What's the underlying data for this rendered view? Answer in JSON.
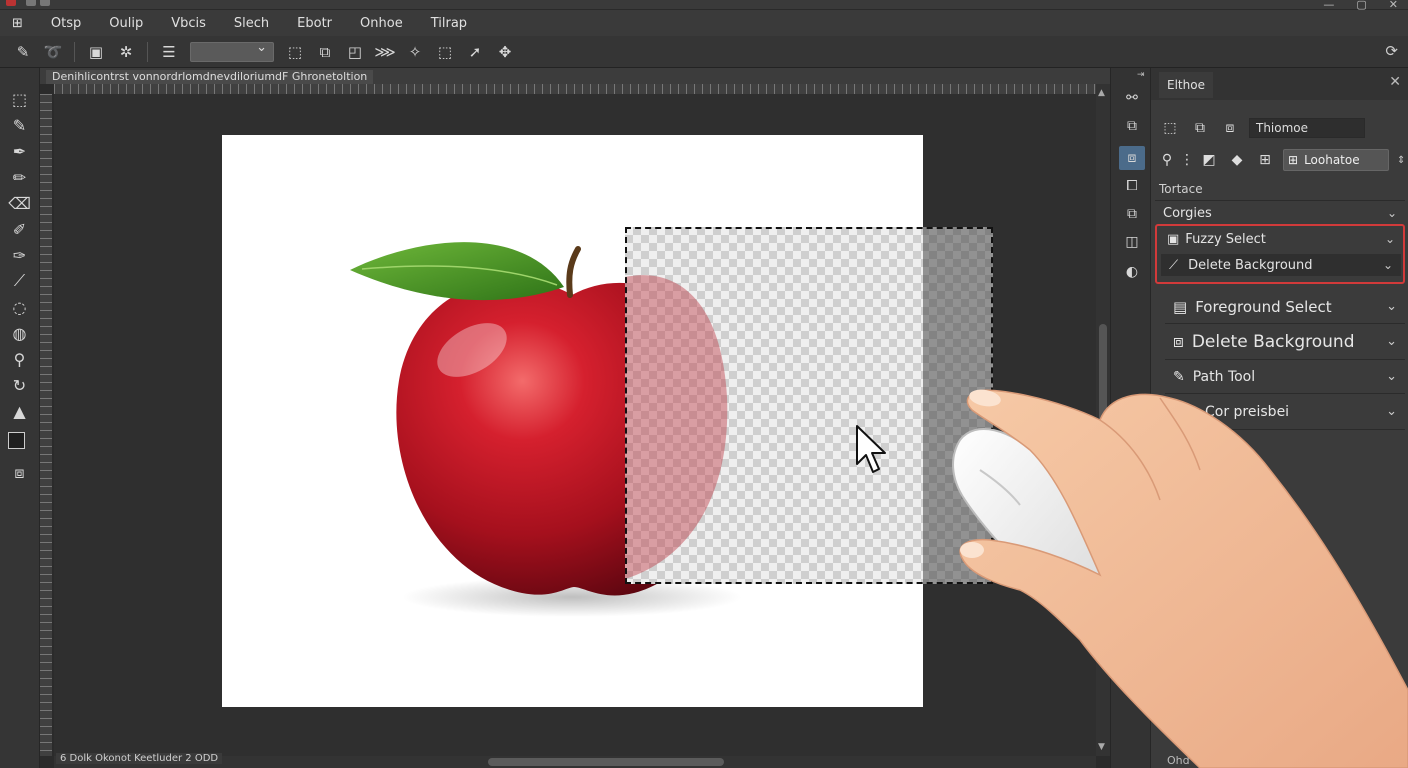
{
  "menu": {
    "items": [
      "Otsp",
      "Oulip",
      "Vbcis",
      "Slech",
      "Ebotr",
      "Onhoe",
      "Tilrap"
    ]
  },
  "icons": {
    "menu_glyph": "⊞"
  },
  "document": {
    "tab_label": "Denihlicontrst vonnordrlomdnevdiloriumdF Ghronetoltion",
    "status_text": "6 Dolk Okonot Keetluder 2 ODD"
  },
  "panel": {
    "tab_label": "Elthoe",
    "field_name": "Thiomoe",
    "dropdown_label": "Loohatoe",
    "section_label": "Tortace",
    "category_label": "Corgies",
    "highlight_row_1": "Fuzzy Select",
    "highlight_row_2": "Delete Background",
    "rows": [
      {
        "label": "Foreground Select"
      },
      {
        "label": "Delete Background"
      },
      {
        "label": "Path Tool"
      },
      {
        "label": "Cor preisbei"
      }
    ],
    "footer": "Ohd"
  },
  "colors": {
    "highlight": "#d23a3a",
    "active_icon": "#4b6b8a",
    "apple_red": "#c0162a",
    "leaf_green": "#4f9a2a"
  }
}
